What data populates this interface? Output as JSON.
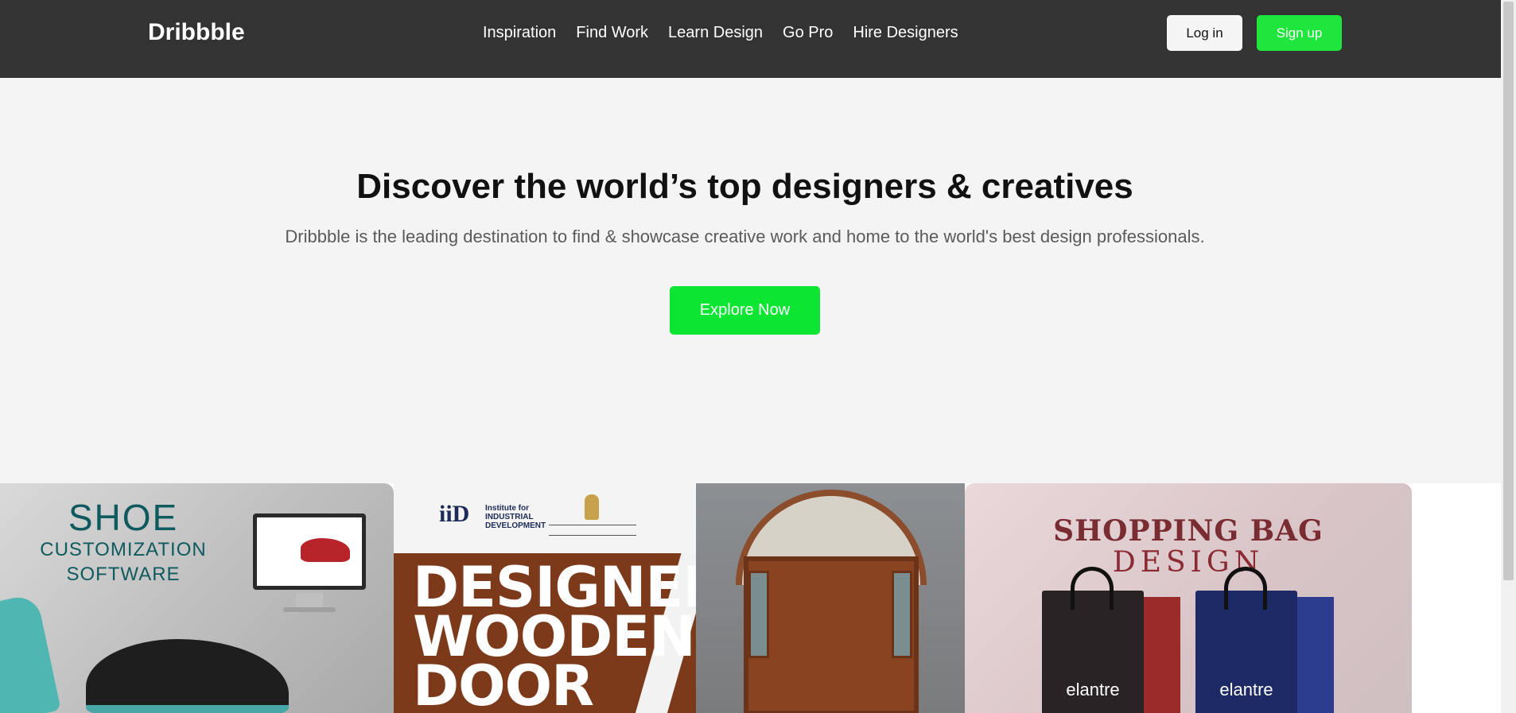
{
  "header": {
    "logo": "Dribbble",
    "nav": [
      "Inspiration",
      "Find Work",
      "Learn Design",
      "Go Pro",
      "Hire Designers"
    ],
    "login_label": "Log in",
    "signup_label": "Sign up"
  },
  "hero": {
    "title": "Discover the world’s top designers & creatives",
    "subtitle": "Dribbble is the leading destination to find & showcase creative work and home to the world's best design professionals.",
    "cta_label": "Explore Now"
  },
  "gallery": {
    "shoe": {
      "title_line1": "SHOE",
      "title_line2": "CUSTOMIZATION",
      "title_line3": "SOFTWARE"
    },
    "door": {
      "logo_mark": "iiD",
      "logo_line1": "Institute for",
      "logo_line2": "INDUSTRIAL",
      "logo_line3": "DEVELOPMENT",
      "title_line1": "DESIGNER",
      "title_line2": "WOODEN",
      "title_line3": "DOOR"
    },
    "bag": {
      "title_line1": "SHOPPING BAG",
      "title_line2": "DESIGN",
      "brand": "elantre"
    }
  },
  "colors": {
    "header_bg": "#333333",
    "hero_bg": "#f4f4f4",
    "accent_green": "#0de533"
  }
}
